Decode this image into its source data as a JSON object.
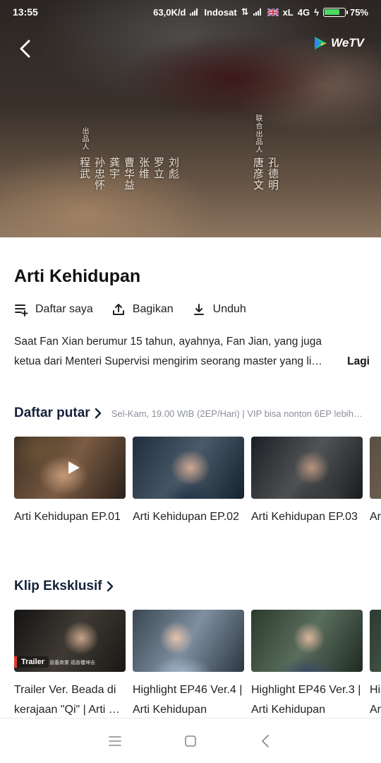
{
  "status_bar": {
    "time": "13:55",
    "data_rate": "63,0K/d",
    "carrier1": "Indosat",
    "carrier2": "xL",
    "network": "4G",
    "battery": "75%",
    "battery_level": 0.75
  },
  "video": {
    "logo_text": "WeTV",
    "credits_left_label": "出品人",
    "credits_left_names": [
      "程武",
      "孙忠怀",
      "龚宇",
      "曹华益",
      "张维",
      "罗立",
      "刘彪"
    ],
    "credits_right_label": "联合出品人",
    "credits_right_names": [
      "唐彦文",
      "孔德明"
    ]
  },
  "show": {
    "title": "Arti Kehidupan",
    "actions": {
      "watchlist": "Daftar saya",
      "share": "Bagikan",
      "download": "Unduh"
    },
    "description_line1": "Saat Fan Xian berumur 15 tahun, ayahnya, Fan Jian, yang juga",
    "description_line2": "ketua dari Menteri Supervisi mengirim seorang master yang li…",
    "more_label": "Lagi"
  },
  "playlist": {
    "title": "Daftar putar",
    "subtitle": "Sel-Kam, 19.00 WIB (2EP/Hari) | VIP bisa nonton 6EP lebih…",
    "items": [
      {
        "title": "Arti Kehidupan EP.01"
      },
      {
        "title": "Arti Kehidupan EP.02"
      },
      {
        "title": "Arti Kehidupan EP.03"
      },
      {
        "title": "Ar"
      }
    ]
  },
  "clips": {
    "title": "Klip Eksklusif",
    "items": [
      {
        "line1": "Trailer Ver. Beada di",
        "line2": "kerajaan \"Qi\" | Arti …",
        "badge": "Trailer",
        "subtitle_text": "滋養商業 福香覆坤去"
      },
      {
        "line1": "Highlight EP46 Ver.4 |",
        "line2": "Arti Kehidupan"
      },
      {
        "line1": "Highlight EP46 Ver.3 |",
        "line2": "Arti Kehidupan"
      },
      {
        "line1": "Hi",
        "line2": "Ar"
      }
    ]
  },
  "colors": {
    "section_title": "#15213b",
    "subtitle_gray": "#8a8f99",
    "logo_green": "#21c17a",
    "trailer_red": "#e8362d"
  }
}
